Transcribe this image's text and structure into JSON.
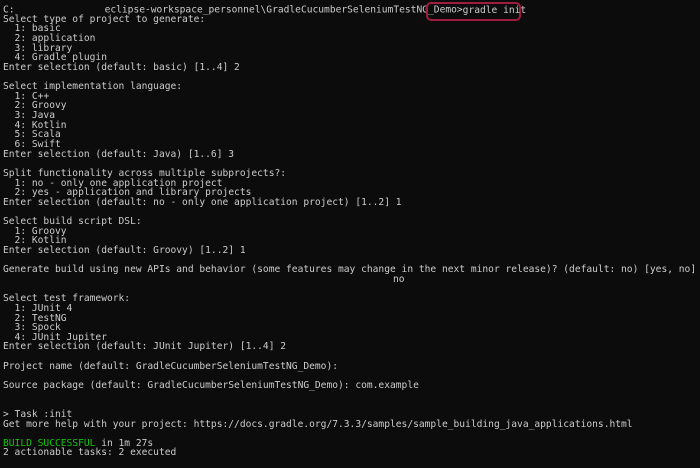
{
  "terminal": {
    "prompt": {
      "drive": "C:",
      "path_rest": "eclipse-workspace_personnel\\GradleCucumberSeleniumTestNG_Demo>",
      "command": "gradle init"
    },
    "lines": [
      "Select type of project to generate:",
      "  1: basic",
      "  2: application",
      "  3: library",
      "  4: Gradle plugin",
      "Enter selection (default: basic) [1..4] 2",
      "",
      "Select implementation language:",
      "  1: C++",
      "  2: Groovy",
      "  3: Java",
      "  4: Kotlin",
      "  5: Scala",
      "  6: Swift",
      "Enter selection (default: Java) [1..6] 3",
      "",
      "Split functionality across multiple subprojects?:",
      "  1: no - only one application project",
      "  2: yes - application and library projects",
      "Enter selection (default: no - only one application project) [1..2] 1",
      "",
      "Select build script DSL:",
      "  1: Groovy",
      "  2: Kotlin",
      "Enter selection (default: Groovy) [1..2] 1",
      "",
      "Generate build using new APIs and behavior (some features may change in the next minor release)? (default: no) [yes, no]"
    ],
    "answer_no": "no",
    "lines2": [
      "",
      "Select test framework:",
      "  1: JUnit 4",
      "  2: TestNG",
      "  3: Spock",
      "  4: JUnit Jupiter",
      "Enter selection (default: JUnit Jupiter) [1..4] 2",
      "",
      "Project name (default: GradleCucumberSeleniumTestNG_Demo):",
      "",
      "Source package (default: GradleCucumberSeleniumTestNG_Demo): com.example",
      "",
      "",
      "> Task :init",
      "Get more help with your project: https://docs.gradle.org/7.3.3/samples/sample_building_java_applications.html",
      ""
    ],
    "build_result": "BUILD SUCCESSFUL",
    "build_time": " in 1m 27s",
    "actionable": "2 actionable tasks: 2 executed"
  },
  "colors": {
    "background": "#0c0c0c",
    "text": "#cccccc",
    "success": "#13c60d",
    "highlight_border": "#9e1c3f"
  }
}
